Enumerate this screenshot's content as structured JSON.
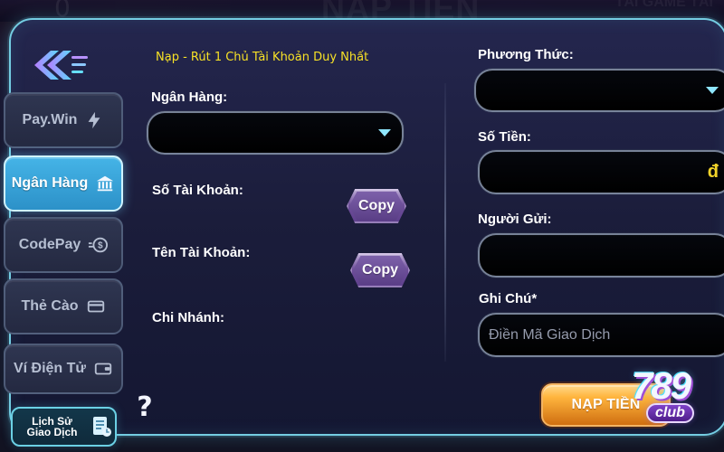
{
  "notice": "Nạp - Rút 1 Chủ Tài Khoản Duy Nhất",
  "sidebar": {
    "items": [
      {
        "label": "Pay.Win",
        "icon": "lightning-icon",
        "active": false
      },
      {
        "label": "Ngân Hàng",
        "icon": "bank-icon",
        "active": true
      },
      {
        "label": "CodePay",
        "icon": "dollar-coin-icon",
        "active": false
      },
      {
        "label": "Thẻ Cào",
        "icon": "card-icon",
        "active": false
      },
      {
        "label": "Ví Điện Tử",
        "icon": "wallet-icon",
        "active": false
      }
    ],
    "history_label_line1": "Lịch Sử",
    "history_label_line2": "Giao Dịch",
    "help_text": "?"
  },
  "left_form": {
    "bank_label": "Ngân Hàng:",
    "account_number_label": "Số Tài Khoản:",
    "account_name_label": "Tên Tài Khoản:",
    "branch_label": "Chi Nhánh:",
    "copy_account_label": "Copy",
    "copy_name_label": "Copy",
    "bank_selected_value": ""
  },
  "right_form": {
    "method_label": "Phương Thức:",
    "method_selected_value": "",
    "amount_label": "Số Tiền:",
    "amount_value": "",
    "amount_suffix": "đ",
    "sender_label": "Người Gửi:",
    "sender_value": "",
    "note_label": "Ghi Chú*",
    "note_value": "",
    "note_placeholder": "Điền Mã Giao Dịch"
  },
  "submit_button": "NẠP TIỀN",
  "brand": {
    "number": "789",
    "club": "club"
  },
  "colors": {
    "accent": "#74cde2",
    "active_tab": "#45b4e7",
    "notice": "#f7e126",
    "submit": "#ffb53e",
    "input_bg": "#000000"
  }
}
